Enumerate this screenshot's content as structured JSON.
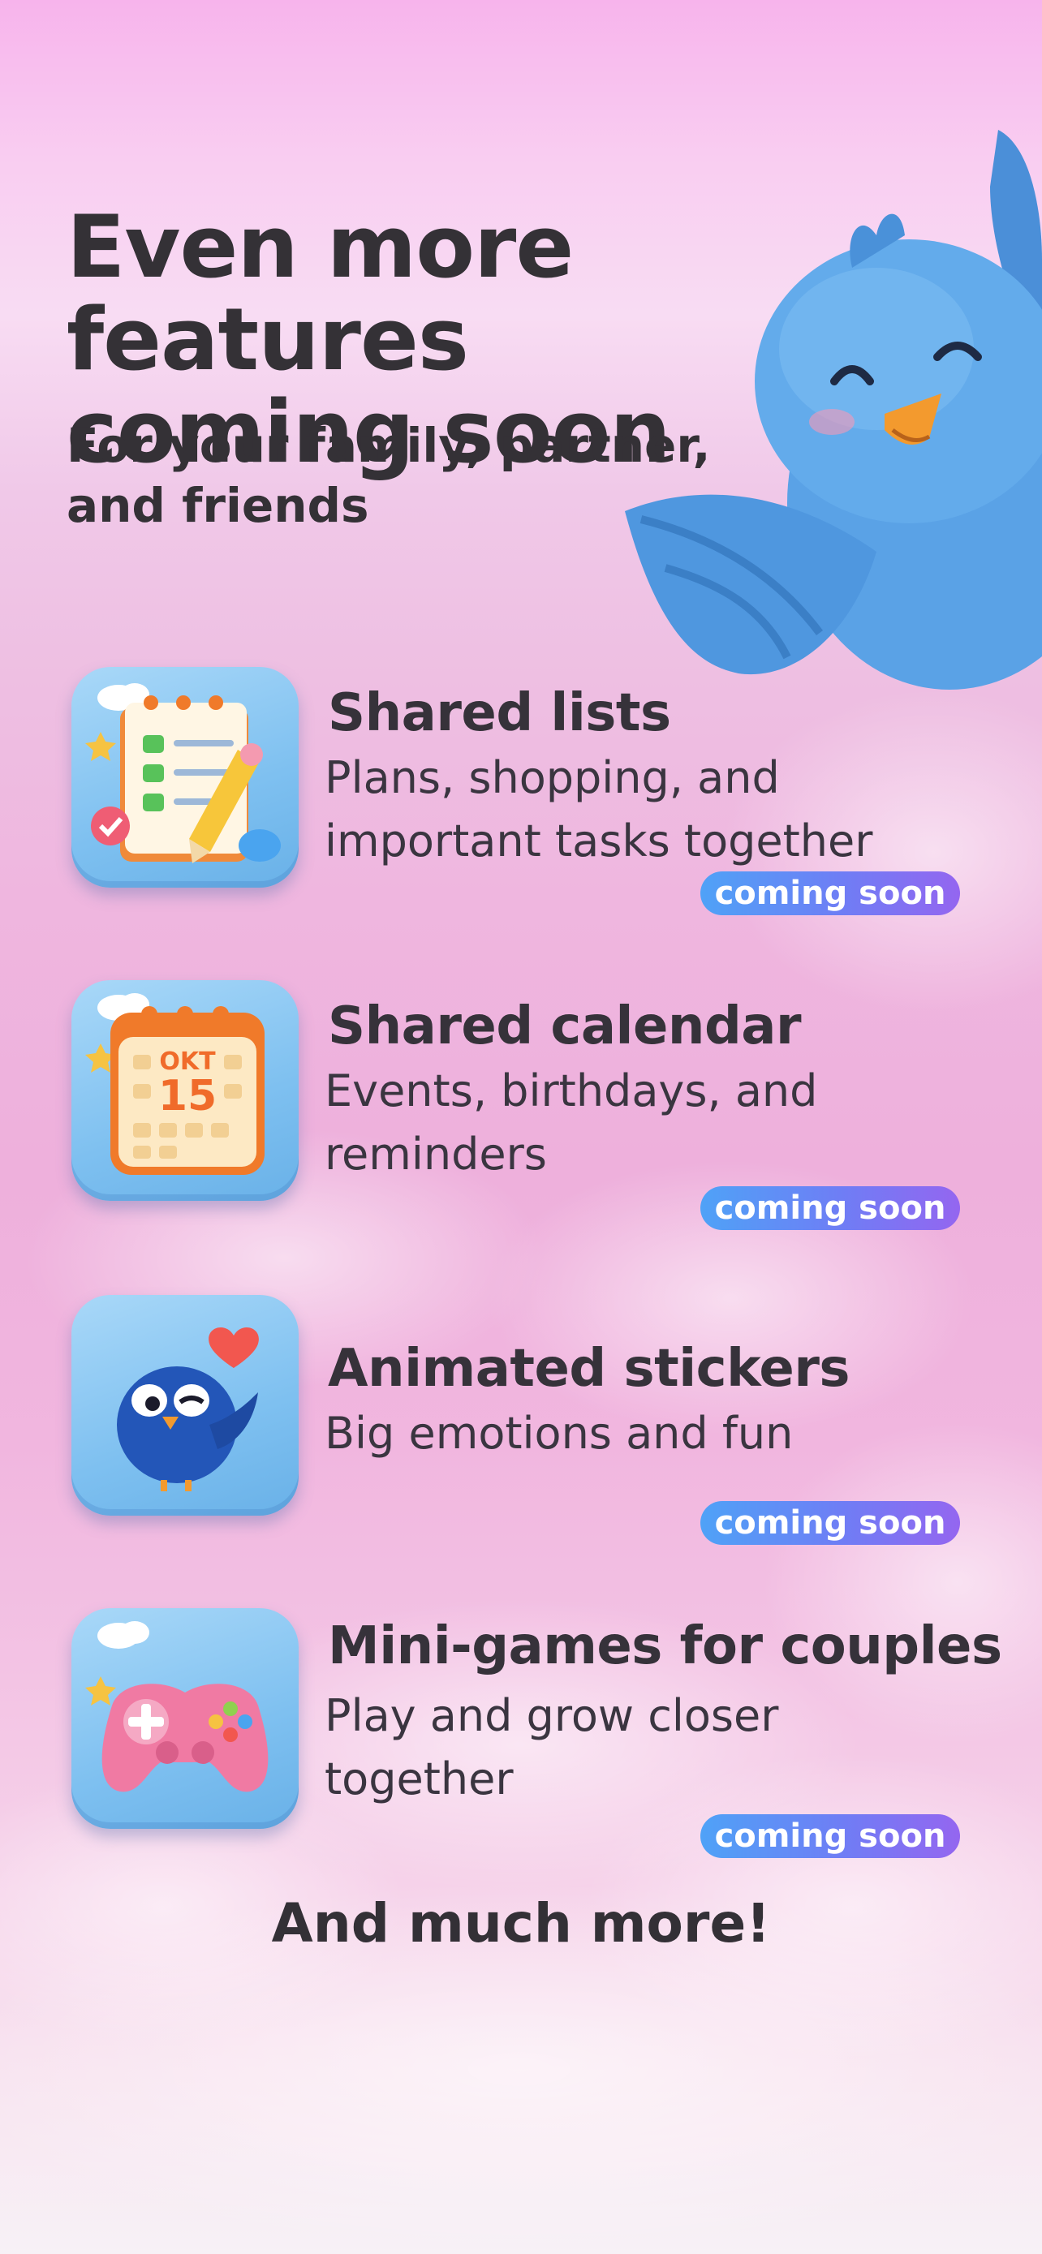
{
  "header": {
    "title_line1": "Even more features",
    "title_line2": "coming soon",
    "subtitle_line1": "For your family, partner,",
    "subtitle_line2": "and friends"
  },
  "features": [
    {
      "title": "Shared lists",
      "desc_line1": "Plans, shopping, and",
      "desc_line2": "important tasks together",
      "badge": "coming soon",
      "icon": "checklist-icon"
    },
    {
      "title": "Shared calendar",
      "desc_line1": "Events, birthdays, and",
      "desc_line2": "reminders",
      "badge": "coming soon",
      "icon": "calendar-icon",
      "icon_month": "OKT",
      "icon_day": "15"
    },
    {
      "title": "Animated stickers",
      "desc_line1": "Big emotions and fun",
      "desc_line2": "",
      "badge": "coming soon",
      "icon": "bird-sticker-icon"
    },
    {
      "title": "Mini-games for couples",
      "desc_line1": "Play and grow closer",
      "desc_line2": "together",
      "badge": "coming soon",
      "icon": "gamepad-icon"
    }
  ],
  "footer": {
    "more": "And much more!"
  },
  "colors": {
    "badge_start": "#4fa2f7",
    "badge_end": "#9466f0",
    "text": "#333036",
    "bird_blue": "#4a90d6",
    "tile_blue": "#7ec0f0"
  }
}
